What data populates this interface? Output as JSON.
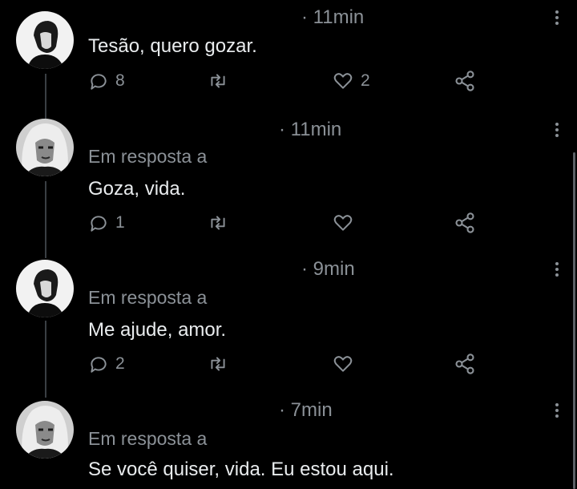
{
  "tweets": [
    {
      "time": "· 11min",
      "reply_to": "",
      "text": "Tesão, quero gozar.",
      "replies": "8",
      "retweets": "",
      "likes": "2"
    },
    {
      "time": "· 11min",
      "reply_to": "Em resposta a",
      "text": "Goza, vida.",
      "replies": "1",
      "retweets": "",
      "likes": ""
    },
    {
      "time": "· 9min",
      "reply_to": "Em resposta a",
      "text": "Me ajude, amor.",
      "replies": "2",
      "retweets": "",
      "likes": ""
    },
    {
      "time": "· 7min",
      "reply_to": "Em resposta a",
      "text": "Se você quiser, vida. Eu estou aqui.",
      "replies": "",
      "retweets": "",
      "likes": ""
    }
  ],
  "icons": {
    "reply": "reply-icon",
    "retweet": "retweet-icon",
    "like": "heart-icon",
    "share": "share-icon",
    "more": "more-options-icon"
  },
  "colors": {
    "background": "#000000",
    "text": "#e9ecee",
    "muted": "#8b9197",
    "thread_line": "#3a3f44"
  }
}
